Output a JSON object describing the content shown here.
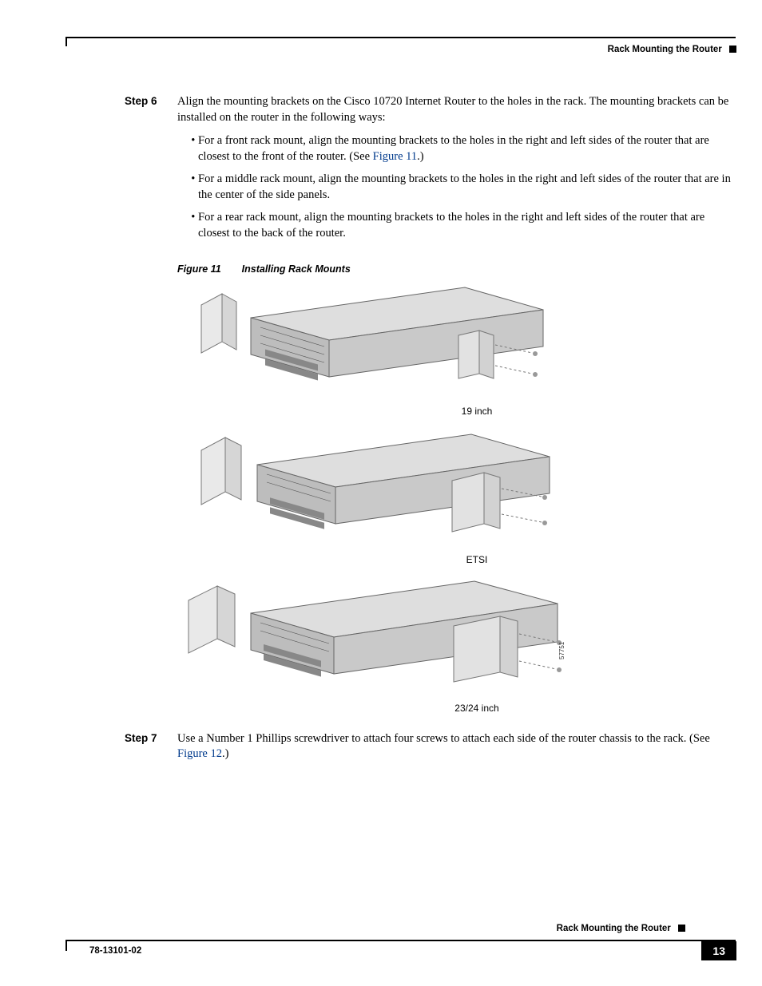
{
  "header": {
    "section": "Rack Mounting the Router"
  },
  "steps": {
    "s6": {
      "label": "Step 6",
      "intro": "Align the mounting brackets on the Cisco 10720 Internet Router to the holes in the rack. The mounting brackets can be installed on the router in the following ways:",
      "b1a": "For a front rack mount, align the mounting brackets to the holes in the right and left sides of the router that are closest to the front of the router. (See ",
      "b1ref": "Figure 11",
      "b1b": ".)",
      "b2": "For a middle rack mount, align the mounting brackets to the holes in the right and left sides of the router that are in the center of the side panels.",
      "b3": "For a rear rack mount, align the mounting brackets to the holes in the right and left sides of the router that are closest to the back of the router."
    },
    "s7": {
      "label": "Step 7",
      "a": "Use a Number 1 Phillips screwdriver to attach four screws to attach each side of the router chassis to the rack. (See ",
      "ref": "Figure 12",
      "b": ".)"
    }
  },
  "figure": {
    "num": "Figure 11",
    "title": "Installing Rack Mounts",
    "labels": {
      "a": "19 inch",
      "b": "ETSI",
      "c": "23/24 inch"
    },
    "callout_id": "57751"
  },
  "footer": {
    "section": "Rack Mounting the Router",
    "docnum": "78-13101-02",
    "page": "13"
  }
}
